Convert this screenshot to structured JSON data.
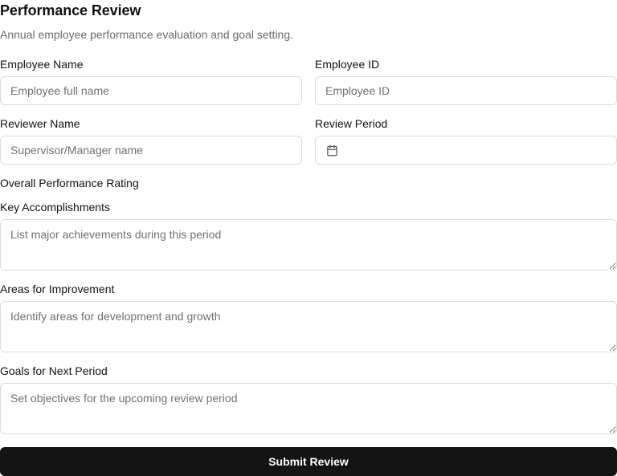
{
  "header": {
    "title": "Performance Review",
    "subtitle": "Annual employee performance evaluation and goal setting."
  },
  "form": {
    "employee_name": {
      "label": "Employee Name",
      "placeholder": "Employee full name",
      "value": ""
    },
    "employee_id": {
      "label": "Employee ID",
      "placeholder": "Employee ID",
      "value": ""
    },
    "reviewer_name": {
      "label": "Reviewer Name",
      "placeholder": "Supervisor/Manager name",
      "value": ""
    },
    "review_period": {
      "label": "Review Period",
      "value": "",
      "icon": "calendar-icon"
    },
    "overall_rating": {
      "label": "Overall Performance Rating"
    },
    "key_accomplishments": {
      "label": "Key Accomplishments",
      "placeholder": "List major achievements during this period",
      "value": ""
    },
    "areas_for_improvement": {
      "label": "Areas for Improvement",
      "placeholder": "Identify areas for development and growth",
      "value": ""
    },
    "goals_next_period": {
      "label": "Goals for Next Period",
      "placeholder": "Set objectives for the upcoming review period",
      "value": ""
    },
    "submit_label": "Submit Review"
  },
  "colors": {
    "primary_button": "#141414",
    "border": "#dcdcdc",
    "placeholder": "#707070"
  }
}
